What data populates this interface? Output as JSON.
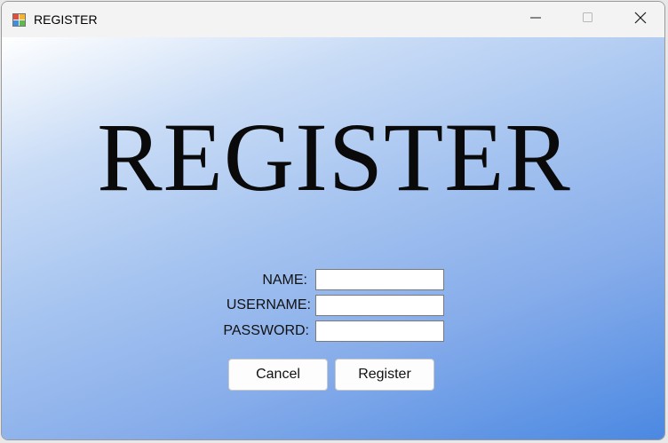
{
  "window": {
    "title": "REGISTER",
    "icons": {
      "app": "app-icon",
      "minimize": "minimize-icon",
      "maximize": "maximize-icon",
      "close": "close-icon"
    }
  },
  "main": {
    "heading": "REGISTER"
  },
  "form": {
    "name_label": "NAME:",
    "username_label": "USERNAME:",
    "password_label": "PASSWORD:",
    "name_value": "",
    "username_value": "",
    "password_value": ""
  },
  "buttons": {
    "cancel_label": "Cancel",
    "register_label": "Register"
  },
  "colors": {
    "gradient_start": "#ffffff",
    "gradient_end": "#4a88e2",
    "titlebar": "#f3f3f3"
  }
}
